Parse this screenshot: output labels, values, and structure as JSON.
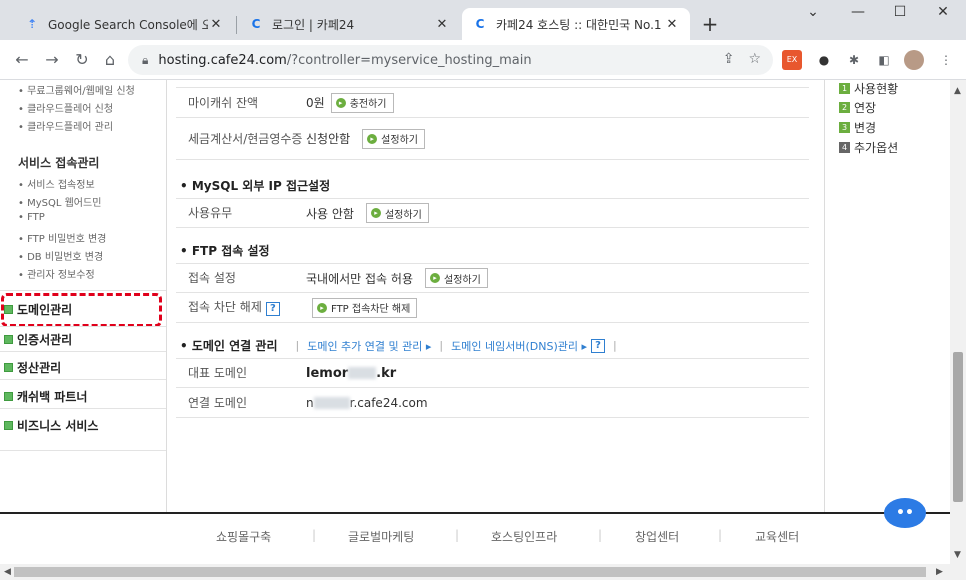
{
  "browser": {
    "tabs": [
      {
        "title": "Google Search Console에 오신",
        "icon": "google-search-console-icon"
      },
      {
        "title": "로그인 | 카페24",
        "icon": "cafe24-icon"
      },
      {
        "title": "카페24 호스팅 :: 대한민국 No.1",
        "icon": "cafe24-icon"
      }
    ],
    "url_host": "hosting.cafe24.com",
    "url_path": "/?controller=myservice_hosting_main"
  },
  "sidebar": {
    "top_items": [
      "• 무료그룹웨어/웹메일 신청",
      "• 클라우드플레어 신청",
      "• 클라우드플레어 관리"
    ],
    "access_header": "서비스 접속관리",
    "access_items": [
      "• 서비스 접속정보",
      "• MySQL 웹어드민",
      "• FTP",
      "• FTP 비밀번호 변경",
      "• DB 비밀번호 변경",
      "• 관리자 정보수정"
    ],
    "sections": [
      "도메인관리",
      "인증서관리",
      "정산관리",
      "캐쉬백 파트너",
      "비즈니스 서비스"
    ]
  },
  "main": {
    "rows_top": [
      {
        "label": "마이캐쉬 잔액",
        "value": "0원",
        "button": "충전하기"
      },
      {
        "label": "세금계산서/현금영수증",
        "value": "신청안함",
        "button": "설정하기"
      }
    ],
    "mysql": {
      "title": "• MySQL 외부 IP 접근설정",
      "label": "사용유무",
      "value": "사용 안함",
      "button": "설정하기"
    },
    "ftp": {
      "title": "• FTP 접속 설정",
      "rows": [
        {
          "label": "접속 설정",
          "value": "국내에서만 접속 허용",
          "button": "설정하기"
        },
        {
          "label": "접속 차단 해제",
          "help": "?",
          "value": "",
          "button": "FTP 접속차단 해제"
        }
      ]
    },
    "domain": {
      "title": "• 도메인 연결 관리",
      "link1": "도메인 추가 연결 및 관리 ▸",
      "link2": "도메인 네임서버(DNS)관리 ▸",
      "help": "?",
      "rep_label": "대표 도메인",
      "rep_prefix": "lemor",
      "rep_suffix": ".kr",
      "conn_label": "연결 도메인",
      "conn_prefix": "n",
      "conn_suffix": "r.cafe24.com"
    }
  },
  "right_panel": {
    "items": [
      {
        "num": "1",
        "label": "사용현황"
      },
      {
        "num": "2",
        "label": "연장"
      },
      {
        "num": "3",
        "label": "변경"
      },
      {
        "num": "4",
        "label": "추가옵션"
      }
    ]
  },
  "footer": {
    "items": [
      "쇼핑몰구축",
      "글로벌마케팅",
      "호스팅인프라",
      "창업센터",
      "교육센터"
    ]
  }
}
